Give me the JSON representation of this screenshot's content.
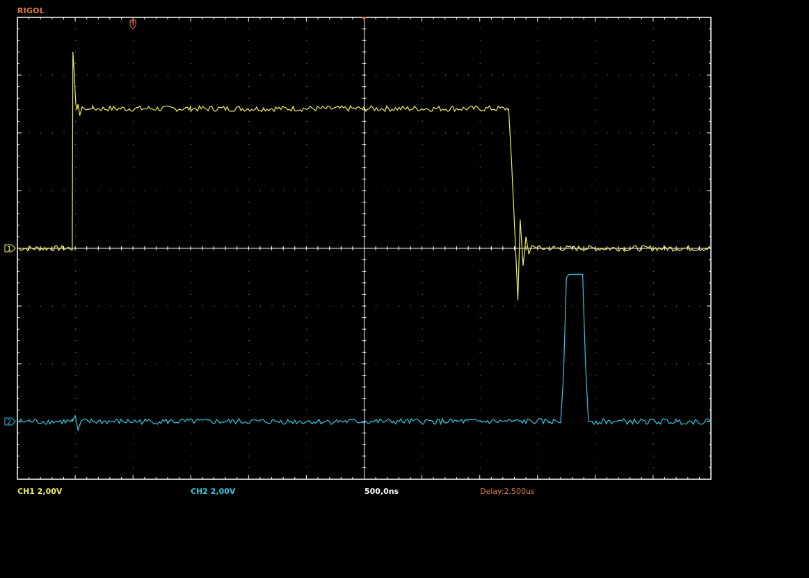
{
  "brand": "RIGOL",
  "colors": {
    "ch1": "#f0f060",
    "ch2": "#33c8e0",
    "frame": "#ffffff",
    "grid": "#a0a0a0",
    "brand": "#e07b3c",
    "delay": "#e07b3c",
    "timebase": "#ffffff"
  },
  "status": {
    "ch1_scale": "CH1 2,00V",
    "ch2_scale": "CH2 2,00V",
    "timebase": "500,0ns",
    "delay": "Delay:2,500us"
  },
  "channel_markers": {
    "ch1": "1",
    "ch2": "2"
  },
  "icons": {
    "trigger_position": "trigger-t-marker-icon",
    "center": "center-arrow-icon"
  },
  "chart_data": {
    "type": "line",
    "title": "",
    "xlabel": "",
    "ylabel": "",
    "x_unit": "divisions",
    "y_unit": "divisions",
    "xlim": [
      0,
      12
    ],
    "ylim": [
      -4,
      4
    ],
    "grid": true,
    "series": [
      {
        "name": "CH1 2,00V",
        "volts_per_div": 2.0,
        "baseline_div": 0.0,
        "x": [
          0,
          0.95,
          0.96,
          0.98,
          1.01,
          1.03,
          1.05,
          1.08,
          1.12,
          1.18,
          1.3,
          3,
          6,
          8.5,
          8.55,
          8.62,
          8.66,
          8.7,
          8.75,
          8.8,
          8.85,
          8.9,
          9.0,
          9.3,
          9.8,
          10.5,
          12
        ],
        "y": [
          0,
          0,
          3.4,
          3.1,
          2.5,
          2.4,
          2.5,
          2.3,
          2.45,
          2.4,
          2.42,
          2.42,
          2.42,
          2.42,
          1.5,
          0,
          -0.9,
          0.5,
          -0.3,
          0.2,
          -0.1,
          0.05,
          0,
          0,
          0,
          0,
          0
        ]
      },
      {
        "name": "CH2 2,00V",
        "volts_per_div": 2.0,
        "baseline_div": -3.0,
        "x": [
          0,
          0.95,
          1.0,
          1.05,
          1.1,
          9.4,
          9.45,
          9.5,
          9.55,
          9.6,
          9.7,
          9.78,
          9.83,
          9.88,
          9.95,
          12
        ],
        "y": [
          -3,
          -3,
          -2.9,
          -3.15,
          -3.0,
          -3.0,
          -2.2,
          -0.5,
          -0.45,
          -0.45,
          -0.45,
          -0.45,
          -2.0,
          -3.0,
          -3.0,
          -3.0
        ]
      }
    ]
  }
}
